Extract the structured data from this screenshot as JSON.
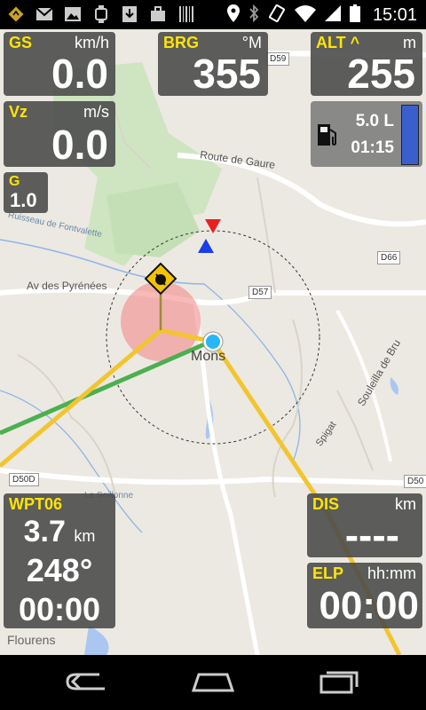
{
  "status": {
    "time": "15:01",
    "icons": [
      "navigation-icon",
      "gmail-icon",
      "image-icon",
      "watch-icon",
      "download-icon",
      "bag-icon",
      "barcode-icon"
    ]
  },
  "panels": {
    "gs": {
      "label": "GS",
      "unit": "km/h",
      "value": "0.0"
    },
    "brg": {
      "label": "BRG",
      "unit": "°M",
      "value": "355"
    },
    "alt": {
      "label": "ALT ^",
      "unit": "m",
      "value": "255"
    },
    "vz": {
      "label": "Vz",
      "unit": "m/s",
      "value": "0.0"
    },
    "g": {
      "label": "G",
      "value": "1.0"
    },
    "fuel": {
      "volume": "5.0 L",
      "time": "01:15"
    },
    "wpt": {
      "label": "WPT06",
      "distance": "3.7",
      "distance_unit": "km",
      "bearing": "248°",
      "time": "00:00"
    },
    "dis": {
      "label": "DIS",
      "unit": "km",
      "value": "----"
    },
    "elp": {
      "label": "ELP",
      "unit": "hh:mm",
      "value": "00:00"
    }
  },
  "map": {
    "town": "Mons",
    "labels": {
      "route_gaure": "Route de Gaure",
      "ruisseau": "Ruisseau de Fontvalette",
      "pyrenees": "Av des Pyrénées",
      "souleilla": "Souleilla de Bru",
      "spigat": "Spigat",
      "seillonne": "La Seillonne",
      "flourens": "Flourens"
    },
    "signs": {
      "d59": "D59",
      "d66": "D66",
      "d57": "D57",
      "d50d": "D50D",
      "d50": "D50"
    }
  },
  "colors": {
    "label_yellow": "#ffe500",
    "track_yellow": "#f2c530",
    "track_green": "#4caf50",
    "panel_bg": "#484848",
    "fuel_bar": "#3a5fcd",
    "circle_pink": "#f48b8b"
  }
}
